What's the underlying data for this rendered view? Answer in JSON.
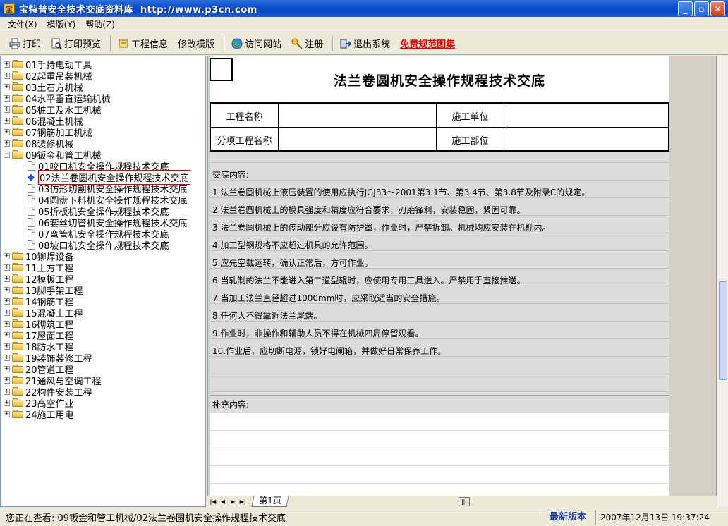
{
  "window": {
    "title": "宝特普安全技术交底资料库  http://www.p3cn.com",
    "min_icon": "minimize-icon",
    "max_icon": "maximize-icon",
    "close_icon": "close-icon"
  },
  "menu": [
    {
      "label": "文件(X)"
    },
    {
      "label": "模版(Y)"
    },
    {
      "label": "帮助(Z)"
    }
  ],
  "toolbar": {
    "print": "打印",
    "print_preview": "打印预览",
    "project_info": "工程信息",
    "edit_template": "修改模版",
    "visit_site": "访问网站",
    "register": "注册",
    "exit": "退出系统",
    "free_atlas": "免费规范图集"
  },
  "tree": {
    "categories": [
      "01手持电动工具",
      "02起重吊装机械",
      "03土石方机械",
      "04水平垂直运输机械",
      "05桩工及水工机械",
      "06混凝土机械",
      "07钢筋加工机械",
      "08装修机械",
      "09钣金和管工机械"
    ],
    "children": [
      "01咬口机安全操作规程技术交底",
      "02法兰卷圆机安全操作规程技术交底",
      "03仿形切割机安全操作规程技术交底",
      "04圆盘下料机安全操作规程技术交底",
      "05折板机安全操作规程技术交底",
      "06套丝切管机安全操作规程技术交底",
      "07弯管机安全操作规程技术交底",
      "08坡口机安全操作规程技术交底"
    ],
    "more_categories": [
      "10铆焊设备",
      "11土方工程",
      "12模板工程",
      "13脚手架工程",
      "14钢筋工程",
      "15混凝土工程",
      "16砌筑工程",
      "17屋面工程",
      "18防水工程",
      "19装饰装修工程",
      "20管道工程",
      "21通风与空调工程",
      "22构件安装工程",
      "23高空作业",
      "24施工用电"
    ]
  },
  "document": {
    "title": "法兰卷圆机安全操作规程技术交底",
    "project_name_label": "工程名称",
    "construction_unit_label": "施工单位",
    "sub_project_label": "分项工程名称",
    "construction_part_label": "施工部位",
    "content_label": "交底内容:",
    "items": [
      "1.法兰卷圆机械上液压装置的使用应执行JGJ33～2001第3.1节、第3.4节、第3.8节及附录C的规定。",
      "2.法兰卷圆机械上的模具强度和精度应符合要求，刃磨锋利，安装稳固，紧固可靠。",
      "3.法兰卷圆机械上的传动部分应设有防护罩，作业时，严禁拆卸。机械均应安装在机棚内。",
      "4.加工型钢规格不应超过机具的允许范围。",
      "5.应先空载运转，确认正常后，方可作业。",
      "6.当轧制的法兰不能进入第二道型辊时，应使用专用工具送入。严禁用手直接推送。",
      "7.当加工法兰直径超过1000mm时，应采取适当的安全措施。",
      "8.任何人不得靠近法兰尾端。",
      "9.作业时，非操作和辅助人员不得在机械四周停留观看。",
      "10.作业后，应切断电源，锁好电闸箱，并做好日常保养工作。"
    ],
    "supplement_label": "补充内容:"
  },
  "sheet_tab": "第1页",
  "status": {
    "viewing": "您正在查看: 09钣金和管工机械/02法兰卷圆机安全操作规程技术交底",
    "version": "最新版本",
    "datetime": "2007年12月13日  19:37:24"
  }
}
